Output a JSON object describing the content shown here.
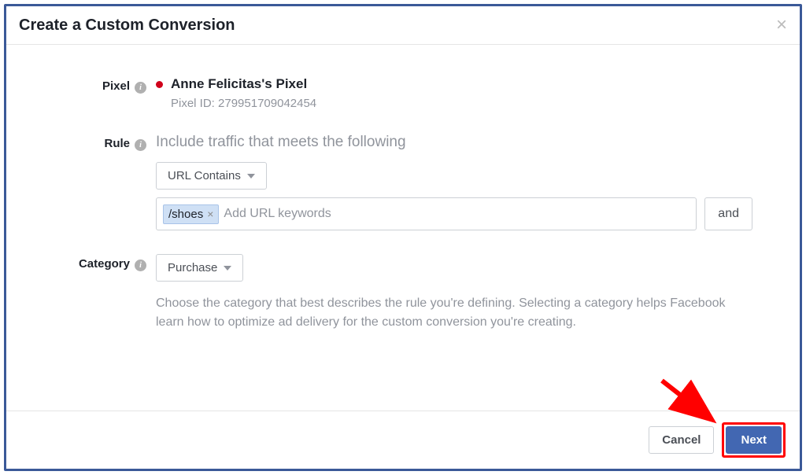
{
  "modal": {
    "title": "Create a Custom Conversion"
  },
  "labels": {
    "pixel": "Pixel",
    "rule": "Rule",
    "category": "Category"
  },
  "pixel": {
    "name": "Anne Felicitas's Pixel",
    "id_label": "Pixel ID: 279951709042454"
  },
  "rule": {
    "heading": "Include traffic that meets the following",
    "condition_label": "URL Contains",
    "tag_value": "/shoes",
    "input_placeholder": "Add URL keywords",
    "and_label": "and"
  },
  "category": {
    "selected": "Purchase",
    "description": "Choose the category that best describes the rule you're defining. Selecting a category helps Facebook learn how to optimize ad delivery for the custom conversion you're creating."
  },
  "footer": {
    "cancel": "Cancel",
    "next": "Next"
  }
}
